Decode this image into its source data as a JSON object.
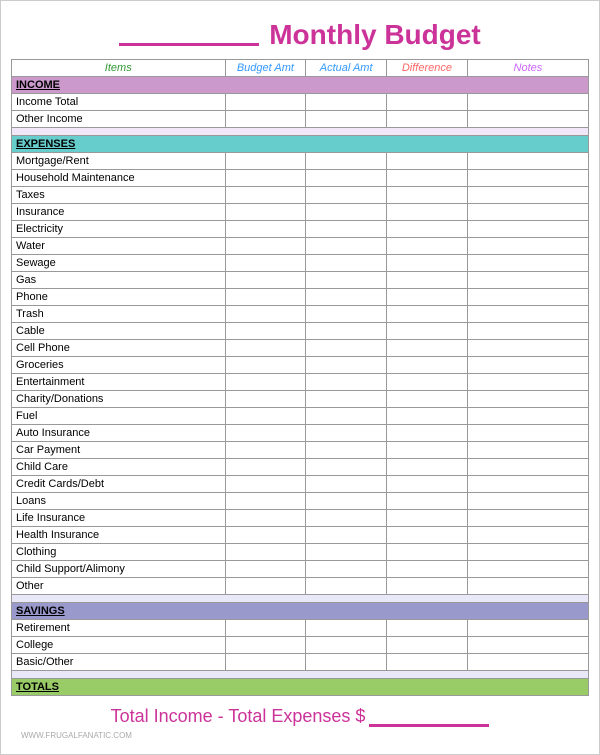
{
  "header": {
    "title": "Monthly Budget"
  },
  "columns": {
    "items": "Items",
    "budget_amt": "Budget Amt",
    "actual_amt": "Actual Amt",
    "difference": "Difference",
    "notes": "Notes"
  },
  "sections": {
    "income": {
      "label": "INCOME",
      "rows": [
        "Income Total",
        "Other Income",
        ""
      ]
    },
    "expenses": {
      "label": "EXPENSES",
      "rows": [
        "Mortgage/Rent",
        "Household Maintenance",
        "Taxes",
        "Insurance",
        "Electricity",
        "Water",
        "Sewage",
        "Gas",
        "Phone",
        "Trash",
        "Cable",
        "Cell Phone",
        "Groceries",
        "Entertainment",
        "Charity/Donations",
        "Fuel",
        "Auto Insurance",
        "Car Payment",
        "Child Care",
        "Credit Cards/Debt",
        "Loans",
        "Life Insurance",
        "Health Insurance",
        "Clothing",
        "Child Support/Alimony",
        "Other",
        ""
      ]
    },
    "savings": {
      "label": "SAVINGS",
      "rows": [
        "Retirement",
        "College",
        "Basic/Other"
      ]
    },
    "totals": {
      "label": "TOTALS"
    }
  },
  "footer": {
    "formula": "Total Income - Total Expenses $"
  },
  "watermark": "WWW.FRUGALFANATIC.COM"
}
